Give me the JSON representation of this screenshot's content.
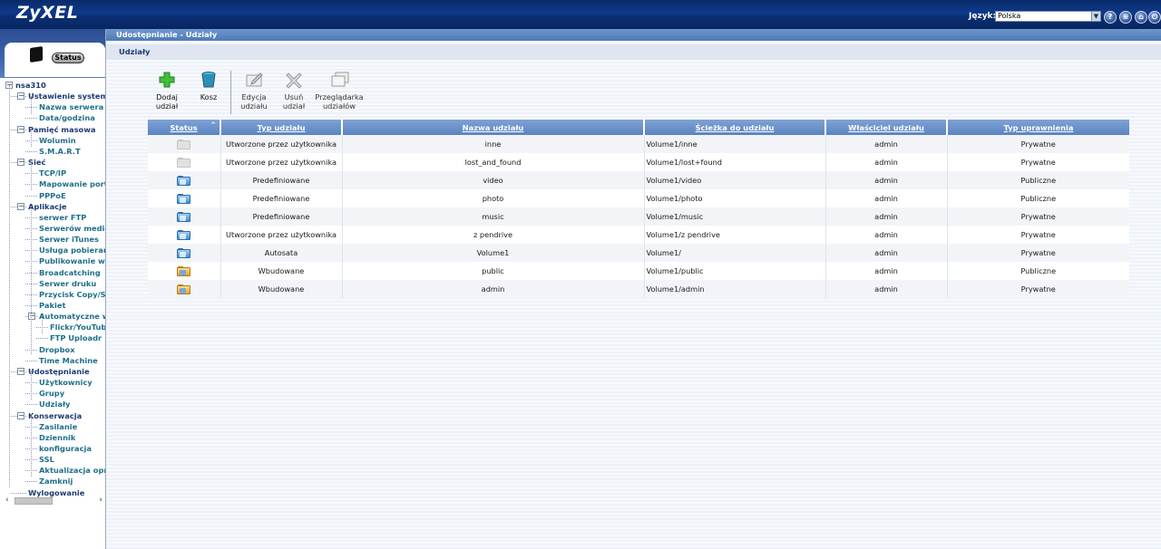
{
  "header": {
    "logo": "ZyXEL",
    "language_label": "Język:",
    "language_value": "Polska",
    "icons": [
      "help-icon",
      "info-icon",
      "home-icon",
      "logout-icon"
    ]
  },
  "sidebar": {
    "status_label": "Status",
    "tree": [
      {
        "label": "nsa310",
        "level": 0
      },
      {
        "label": "Ustawienie systemu",
        "level": 1
      },
      {
        "label": "Nazwa serwera",
        "level": 2
      },
      {
        "label": "Data/godzina",
        "level": 2
      },
      {
        "label": "Pamięć masowa",
        "level": 1
      },
      {
        "label": "Wolumin",
        "level": 2
      },
      {
        "label": "S.M.A.R.T",
        "level": 2
      },
      {
        "label": "Sieć",
        "level": 1
      },
      {
        "label": "TCP/IP",
        "level": 2
      },
      {
        "label": "Mapowanie portów",
        "level": 2
      },
      {
        "label": "PPPoE",
        "level": 2
      },
      {
        "label": "Aplikacje",
        "level": 1
      },
      {
        "label": "serwer FTP",
        "level": 2
      },
      {
        "label": "Serwerów mediów",
        "level": 2
      },
      {
        "label": "Serwer iTunes",
        "level": 2
      },
      {
        "label": "Usługa pobierania",
        "level": 2
      },
      {
        "label": "Publikowanie w sieci",
        "level": 2
      },
      {
        "label": "Broadcatching",
        "level": 2
      },
      {
        "label": "Serwer druku",
        "level": 2
      },
      {
        "label": "Przycisk Copy/Sync",
        "level": 2
      },
      {
        "label": "Pakiet",
        "level": 2
      },
      {
        "label": "Automatyczne wysyłanie",
        "level": 2
      },
      {
        "label": "Flickr/YouTube",
        "level": 3
      },
      {
        "label": "FTP Uploadr",
        "level": 3
      },
      {
        "label": "Dropbox",
        "level": 2
      },
      {
        "label": "Time Machine",
        "level": 2
      },
      {
        "label": "Udostępnianie",
        "level": 1
      },
      {
        "label": "Użytkownicy",
        "level": 2
      },
      {
        "label": "Grupy",
        "level": 2
      },
      {
        "label": "Udziały",
        "level": 2
      },
      {
        "label": "Konserwacja",
        "level": 1
      },
      {
        "label": "Zasilanie",
        "level": 2
      },
      {
        "label": "Dziennik",
        "level": 2
      },
      {
        "label": "konfiguracja",
        "level": 2
      },
      {
        "label": "SSL",
        "level": 2
      },
      {
        "label": "Aktualizacja oprogramowania",
        "level": 2
      },
      {
        "label": "Zamknij",
        "level": 2
      },
      {
        "label": "Wylogowanie",
        "level": 1
      }
    ]
  },
  "main": {
    "breadcrumb": "Udostępnianie - Udziały",
    "section_title": "Udziały",
    "toolbar": {
      "add": "Dodaj udział",
      "trash": "Kosz",
      "edit": "Edycja udziału",
      "delete": "Usuń udział",
      "browser": "Przeglądarka udziałów"
    },
    "table": {
      "columns": [
        "Status",
        "Typ udziału",
        "Nazwa udziału",
        "Ścieżka do udziału",
        "Właściciel udziału",
        "Typ uprawnienia"
      ],
      "rows": [
        {
          "icon": "grey-folder-icon",
          "type": "Utworzone przez użytkownika",
          "name": "inne",
          "path": "Volume1/inne",
          "owner": "admin",
          "permission": "Prywatne"
        },
        {
          "icon": "grey-folder-icon",
          "type": "Utworzone przez użytkownika",
          "name": "lost_and_found",
          "path": "Volume1/lost+found",
          "owner": "admin",
          "permission": "Prywatne"
        },
        {
          "icon": "blue-shared-folder-icon",
          "type": "Predefiniowane",
          "name": "video",
          "path": "Volume1/video",
          "owner": "admin",
          "permission": "Publiczne"
        },
        {
          "icon": "blue-shared-folder-icon",
          "type": "Predefiniowane",
          "name": "photo",
          "path": "Volume1/photo",
          "owner": "admin",
          "permission": "Publiczne"
        },
        {
          "icon": "blue-shared-folder-icon",
          "type": "Predefiniowane",
          "name": "music",
          "path": "Volume1/music",
          "owner": "admin",
          "permission": "Prywatne"
        },
        {
          "icon": "blue-shared-folder-icon",
          "type": "Utworzone przez użytkownika",
          "name": "z pendrive",
          "path": "Volume1/z pendrive",
          "owner": "admin",
          "permission": "Prywatne"
        },
        {
          "icon": "blue-shared-folder-icon",
          "type": "Autosata",
          "name": "Volume1",
          "path": "Volume1/",
          "owner": "admin",
          "permission": "Prywatne"
        },
        {
          "icon": "orange-builtin-folder-icon",
          "type": "Wbudowane",
          "name": "public",
          "path": "Volume1/public",
          "owner": "admin",
          "permission": "Publiczne"
        },
        {
          "icon": "orange-builtin-folder-icon",
          "type": "Wbudowane",
          "name": "admin",
          "path": "Volume1/admin",
          "owner": "admin",
          "permission": "Prywatne"
        }
      ]
    }
  }
}
